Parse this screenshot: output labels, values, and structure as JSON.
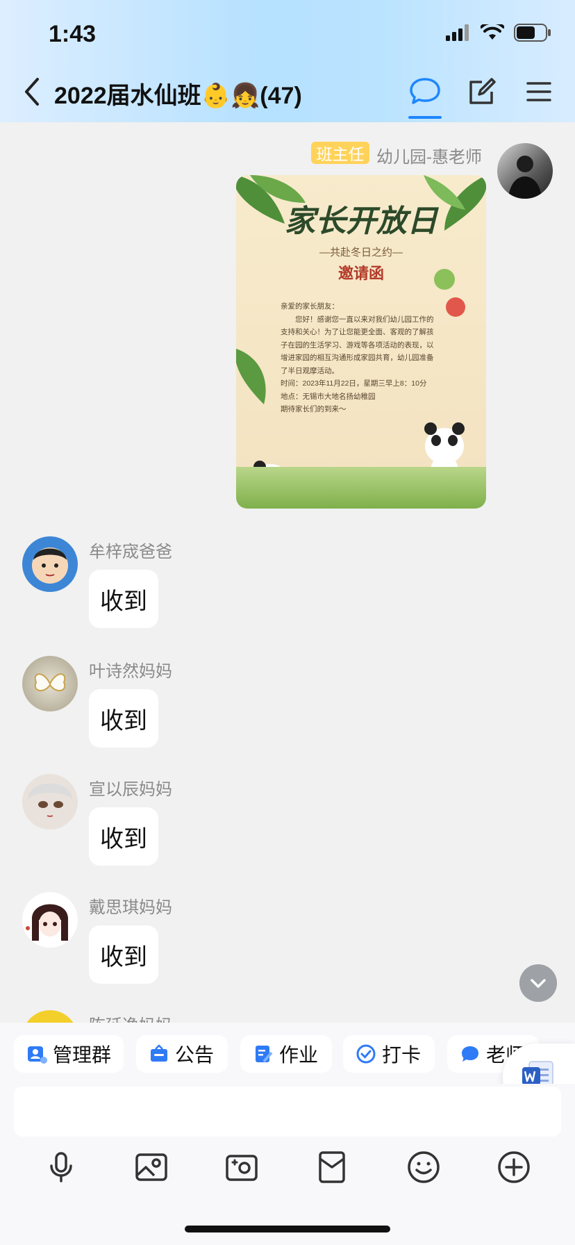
{
  "status": {
    "time": "1:43"
  },
  "nav": {
    "title": "2022届水仙班👶👧(47)"
  },
  "teacher_msg": {
    "role_badge": "班主任",
    "sender": "幼儿园-惠老师",
    "invite": {
      "title": "家长开放日",
      "subtitle": "—共赴冬日之约—",
      "heading": "邀请函",
      "lines": [
        "亲爱的家长朋友：",
        "您好！感谢您一直以来对我们幼儿园工作的支持和关心！为了让您能更全面、客观的了解孩子在园的生活学习、游戏等各项活动的表现，以增进家园的相互沟通形成家园共育，幼儿园准备了半日观摩活动。",
        "时间：2023年11月22日，星期三早上8：10分",
        "地点：无锡市大地名扬幼稚园",
        "期待家长们的到来～"
      ]
    }
  },
  "messages": [
    {
      "name": "牟梓宬爸爸",
      "text": "收到"
    },
    {
      "name": "叶诗然妈妈",
      "text": "收到"
    },
    {
      "name": "宣以辰妈妈",
      "text": "收到"
    },
    {
      "name": "戴思琪妈妈",
      "text": "收到"
    },
    {
      "name": "陈延逸妈妈",
      "text": ""
    }
  ],
  "quick_actions": [
    {
      "label": "管理群",
      "icon": "manage-group-icon",
      "color": "#2f7bf5"
    },
    {
      "label": "公告",
      "icon": "notice-icon",
      "color": "#2f7bf5"
    },
    {
      "label": "作业",
      "icon": "homework-icon",
      "color": "#2f7bf5"
    },
    {
      "label": "打卡",
      "icon": "checkin-icon",
      "color": "#2f7bf5"
    },
    {
      "label": "老师",
      "icon": "teacher-icon",
      "color": "#2f7bf5"
    }
  ],
  "colors": {
    "accent": "#1e86ff",
    "badge": "#ffd35a"
  }
}
